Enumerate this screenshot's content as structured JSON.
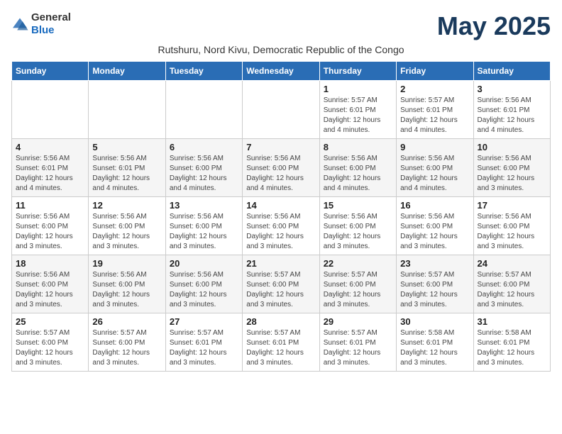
{
  "logo": {
    "general": "General",
    "blue": "Blue"
  },
  "header": {
    "month_year": "May 2025",
    "subtitle": "Rutshuru, Nord Kivu, Democratic Republic of the Congo"
  },
  "days_of_week": [
    "Sunday",
    "Monday",
    "Tuesday",
    "Wednesday",
    "Thursday",
    "Friday",
    "Saturday"
  ],
  "weeks": [
    [
      {
        "day": "",
        "sunrise": "",
        "sunset": "",
        "daylight": ""
      },
      {
        "day": "",
        "sunrise": "",
        "sunset": "",
        "daylight": ""
      },
      {
        "day": "",
        "sunrise": "",
        "sunset": "",
        "daylight": ""
      },
      {
        "day": "",
        "sunrise": "",
        "sunset": "",
        "daylight": ""
      },
      {
        "day": "1",
        "sunrise": "Sunrise: 5:57 AM",
        "sunset": "Sunset: 6:01 PM",
        "daylight": "Daylight: 12 hours and 4 minutes."
      },
      {
        "day": "2",
        "sunrise": "Sunrise: 5:57 AM",
        "sunset": "Sunset: 6:01 PM",
        "daylight": "Daylight: 12 hours and 4 minutes."
      },
      {
        "day": "3",
        "sunrise": "Sunrise: 5:56 AM",
        "sunset": "Sunset: 6:01 PM",
        "daylight": "Daylight: 12 hours and 4 minutes."
      }
    ],
    [
      {
        "day": "4",
        "sunrise": "Sunrise: 5:56 AM",
        "sunset": "Sunset: 6:01 PM",
        "daylight": "Daylight: 12 hours and 4 minutes."
      },
      {
        "day": "5",
        "sunrise": "Sunrise: 5:56 AM",
        "sunset": "Sunset: 6:01 PM",
        "daylight": "Daylight: 12 hours and 4 minutes."
      },
      {
        "day": "6",
        "sunrise": "Sunrise: 5:56 AM",
        "sunset": "Sunset: 6:00 PM",
        "daylight": "Daylight: 12 hours and 4 minutes."
      },
      {
        "day": "7",
        "sunrise": "Sunrise: 5:56 AM",
        "sunset": "Sunset: 6:00 PM",
        "daylight": "Daylight: 12 hours and 4 minutes."
      },
      {
        "day": "8",
        "sunrise": "Sunrise: 5:56 AM",
        "sunset": "Sunset: 6:00 PM",
        "daylight": "Daylight: 12 hours and 4 minutes."
      },
      {
        "day": "9",
        "sunrise": "Sunrise: 5:56 AM",
        "sunset": "Sunset: 6:00 PM",
        "daylight": "Daylight: 12 hours and 4 minutes."
      },
      {
        "day": "10",
        "sunrise": "Sunrise: 5:56 AM",
        "sunset": "Sunset: 6:00 PM",
        "daylight": "Daylight: 12 hours and 3 minutes."
      }
    ],
    [
      {
        "day": "11",
        "sunrise": "Sunrise: 5:56 AM",
        "sunset": "Sunset: 6:00 PM",
        "daylight": "Daylight: 12 hours and 3 minutes."
      },
      {
        "day": "12",
        "sunrise": "Sunrise: 5:56 AM",
        "sunset": "Sunset: 6:00 PM",
        "daylight": "Daylight: 12 hours and 3 minutes."
      },
      {
        "day": "13",
        "sunrise": "Sunrise: 5:56 AM",
        "sunset": "Sunset: 6:00 PM",
        "daylight": "Daylight: 12 hours and 3 minutes."
      },
      {
        "day": "14",
        "sunrise": "Sunrise: 5:56 AM",
        "sunset": "Sunset: 6:00 PM",
        "daylight": "Daylight: 12 hours and 3 minutes."
      },
      {
        "day": "15",
        "sunrise": "Sunrise: 5:56 AM",
        "sunset": "Sunset: 6:00 PM",
        "daylight": "Daylight: 12 hours and 3 minutes."
      },
      {
        "day": "16",
        "sunrise": "Sunrise: 5:56 AM",
        "sunset": "Sunset: 6:00 PM",
        "daylight": "Daylight: 12 hours and 3 minutes."
      },
      {
        "day": "17",
        "sunrise": "Sunrise: 5:56 AM",
        "sunset": "Sunset: 6:00 PM",
        "daylight": "Daylight: 12 hours and 3 minutes."
      }
    ],
    [
      {
        "day": "18",
        "sunrise": "Sunrise: 5:56 AM",
        "sunset": "Sunset: 6:00 PM",
        "daylight": "Daylight: 12 hours and 3 minutes."
      },
      {
        "day": "19",
        "sunrise": "Sunrise: 5:56 AM",
        "sunset": "Sunset: 6:00 PM",
        "daylight": "Daylight: 12 hours and 3 minutes."
      },
      {
        "day": "20",
        "sunrise": "Sunrise: 5:56 AM",
        "sunset": "Sunset: 6:00 PM",
        "daylight": "Daylight: 12 hours and 3 minutes."
      },
      {
        "day": "21",
        "sunrise": "Sunrise: 5:57 AM",
        "sunset": "Sunset: 6:00 PM",
        "daylight": "Daylight: 12 hours and 3 minutes."
      },
      {
        "day": "22",
        "sunrise": "Sunrise: 5:57 AM",
        "sunset": "Sunset: 6:00 PM",
        "daylight": "Daylight: 12 hours and 3 minutes."
      },
      {
        "day": "23",
        "sunrise": "Sunrise: 5:57 AM",
        "sunset": "Sunset: 6:00 PM",
        "daylight": "Daylight: 12 hours and 3 minutes."
      },
      {
        "day": "24",
        "sunrise": "Sunrise: 5:57 AM",
        "sunset": "Sunset: 6:00 PM",
        "daylight": "Daylight: 12 hours and 3 minutes."
      }
    ],
    [
      {
        "day": "25",
        "sunrise": "Sunrise: 5:57 AM",
        "sunset": "Sunset: 6:00 PM",
        "daylight": "Daylight: 12 hours and 3 minutes."
      },
      {
        "day": "26",
        "sunrise": "Sunrise: 5:57 AM",
        "sunset": "Sunset: 6:00 PM",
        "daylight": "Daylight: 12 hours and 3 minutes."
      },
      {
        "day": "27",
        "sunrise": "Sunrise: 5:57 AM",
        "sunset": "Sunset: 6:01 PM",
        "daylight": "Daylight: 12 hours and 3 minutes."
      },
      {
        "day": "28",
        "sunrise": "Sunrise: 5:57 AM",
        "sunset": "Sunset: 6:01 PM",
        "daylight": "Daylight: 12 hours and 3 minutes."
      },
      {
        "day": "29",
        "sunrise": "Sunrise: 5:57 AM",
        "sunset": "Sunset: 6:01 PM",
        "daylight": "Daylight: 12 hours and 3 minutes."
      },
      {
        "day": "30",
        "sunrise": "Sunrise: 5:58 AM",
        "sunset": "Sunset: 6:01 PM",
        "daylight": "Daylight: 12 hours and 3 minutes."
      },
      {
        "day": "31",
        "sunrise": "Sunrise: 5:58 AM",
        "sunset": "Sunset: 6:01 PM",
        "daylight": "Daylight: 12 hours and 3 minutes."
      }
    ]
  ]
}
